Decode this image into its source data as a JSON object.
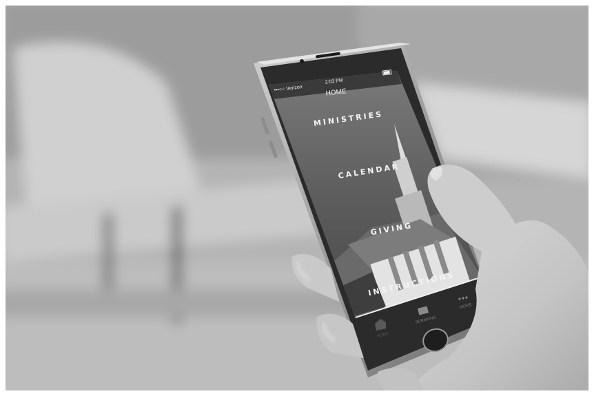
{
  "status_bar": {
    "carrier": "•••○○ Verizon",
    "time": "2:03 PM"
  },
  "nav": {
    "title": "HOME"
  },
  "menu": {
    "items": [
      {
        "label": "MINISTRIES"
      },
      {
        "label": "CALENDAR"
      },
      {
        "label": "GIVING"
      },
      {
        "label": "INSTRUCTIONS"
      }
    ]
  },
  "tab_bar": {
    "tabs": [
      {
        "label": "HOME",
        "icon": "home-icon"
      },
      {
        "label": "SERMONS",
        "icon": "book-icon"
      },
      {
        "label": "MORE",
        "icon": "more-icon"
      }
    ]
  }
}
